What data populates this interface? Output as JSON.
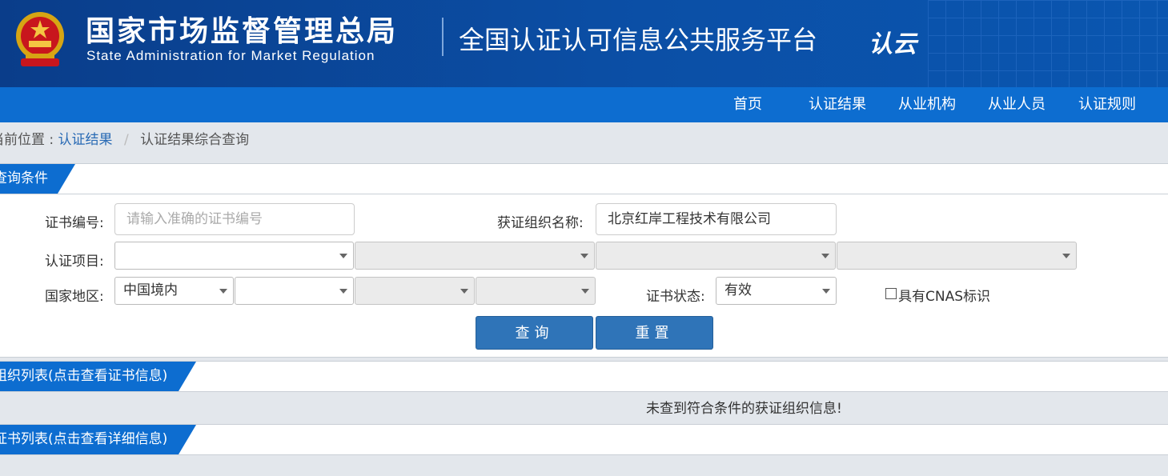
{
  "header": {
    "org_name_cn": "国家市场监督管理总局",
    "org_name_en": "State Administration  for  Market Regulation",
    "platform_title": "全国认证认可信息公共服务平台",
    "brand_mark": "认云"
  },
  "nav": {
    "items": [
      {
        "label": "首页"
      },
      {
        "label": "认证结果"
      },
      {
        "label": "从业机构"
      },
      {
        "label": "从业人员"
      },
      {
        "label": "认证规则"
      }
    ]
  },
  "breadcrumb": {
    "prefix": "当前位置 :",
    "link": "认证结果",
    "current": "认证结果综合查询"
  },
  "query": {
    "title": "查询条件",
    "cert_no_label": "证书编号:",
    "cert_no_placeholder": "请输入准确的证书编号",
    "org_name_label": "获证组织名称:",
    "org_name_value": "北京红岸工程技术有限公司",
    "project_label": "认证项目:",
    "region_label": "国家地区:",
    "region_value": "中国境内",
    "status_label": "证书状态:",
    "status_value": "有效",
    "cnas_label": "具有CNAS标识",
    "search_button": "查询",
    "reset_button": "重置"
  },
  "org_list": {
    "title": "组织列表(点击查看证书信息)",
    "empty_message": "未查到符合条件的获证组织信息!"
  },
  "cert_list": {
    "title": "证书列表(点击查看详细信息)"
  },
  "colors": {
    "header_bg": "#0b4fa6",
    "nav_bg": "#0d6dd0",
    "button_bg": "#2f74b8",
    "link": "#2a6bb5"
  }
}
